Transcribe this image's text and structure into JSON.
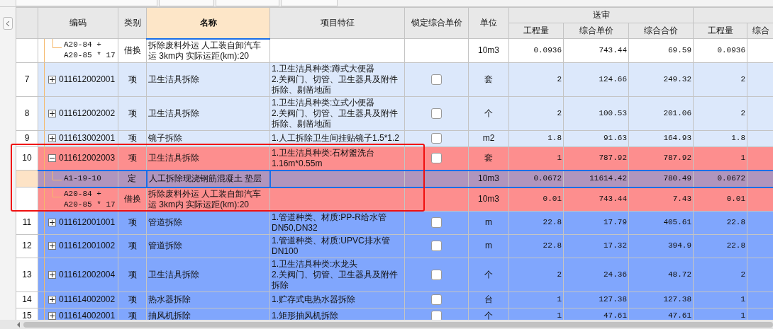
{
  "columns": [
    {
      "label": "编码",
      "selected": false
    },
    {
      "label": "类别",
      "selected": false
    },
    {
      "label": "名称",
      "selected": true
    },
    {
      "label": "项目特征",
      "selected": false
    },
    {
      "label": "锁定综合单价",
      "selected": false
    },
    {
      "label": "单位",
      "selected": false
    }
  ],
  "groups": [
    {
      "label": "送审",
      "columns": [
        "工程量",
        "综合单价",
        "综合合价"
      ]
    },
    {
      "columns": [
        "工程量",
        "综合"
      ]
    }
  ],
  "rows": [
    {
      "kind": "sub",
      "code": "A20-84 +\nA20-85 * 17",
      "type": "借换",
      "name": "拆除废料外运 人工装自卸汽车运 3km内  实际运距(km):20",
      "unit": "10m3",
      "values": [
        "0.0936",
        "743.44",
        "69.59",
        "0.0936"
      ],
      "color": "#ffffff",
      "selected": false
    },
    {
      "kind": "item",
      "number": "7",
      "expanded": false,
      "code": "011612002001",
      "type": "项",
      "name": "卫生洁具拆除",
      "features": "1.卫生洁具种类:蹲式大便器\n2.关阀门、切管、卫生器具及附件拆除、剔凿地面",
      "locked": false,
      "unit": "套",
      "values": [
        "2",
        "124.66",
        "249.32",
        "2"
      ],
      "color": "#dce8fb",
      "selected": false
    },
    {
      "kind": "item",
      "number": "8",
      "expanded": false,
      "code": "011612002002",
      "type": "项",
      "name": "卫生洁具拆除",
      "features": "1.卫生洁具种类:立式小便器\n2.关阀门、切管、卫生器具及附件拆除、剔凿地面",
      "locked": false,
      "unit": "个",
      "values": [
        "2",
        "100.53",
        "201.06",
        "2"
      ],
      "color": "#dce8fb",
      "selected": false
    },
    {
      "kind": "item",
      "number": "9",
      "expanded": false,
      "code": "011613002001",
      "type": "项",
      "name": "镜子拆除",
      "features": "1.人工拆除卫生间挂贴镜子1.5*1.2",
      "locked": false,
      "unit": "m2",
      "values": [
        "1.8",
        "91.63",
        "164.93",
        "1.8"
      ],
      "color": "#dce8fb",
      "selected": false
    },
    {
      "kind": "item",
      "number": "10",
      "expanded": true,
      "code": "011612002003",
      "type": "项",
      "name": "卫生洁具拆除",
      "features": "1.卫生洁具种类:石材盥洗台\n1.16m*0.55m",
      "locked": false,
      "unit": "套",
      "values": [
        "1",
        "787.92",
        "787.92",
        "1"
      ],
      "color": "#fd8e8e",
      "selected": false
    },
    {
      "kind": "sub",
      "code": "A1-19-10",
      "type": "定",
      "name": "人工拆除现浇钢筋混凝土 垫层",
      "unit": "10m3",
      "values": [
        "0.0672",
        "11614.42",
        "780.49",
        "0.0672"
      ],
      "color": "#b095bd",
      "selected": true
    },
    {
      "kind": "sub",
      "code": "A20-84 +\nA20-85 * 17",
      "type": "借换",
      "name": "拆除废料外运 人工装自卸汽车运 3km内  实际运距(km):20",
      "unit": "10m3",
      "values": [
        "0.01",
        "743.44",
        "7.43",
        "0.01"
      ],
      "color": "#fd8e8e",
      "selected": false
    },
    {
      "kind": "item",
      "number": "11",
      "expanded": false,
      "code": "011612001001",
      "type": "项",
      "name": "管道拆除",
      "features": "1.管道种类、材质:PP-R给水管\nDN50,DN32",
      "locked": false,
      "unit": "m",
      "values": [
        "22.8",
        "17.79",
        "405.61",
        "22.8"
      ],
      "color": "#80a6fd",
      "selected": false
    },
    {
      "kind": "item",
      "number": "12",
      "expanded": false,
      "code": "011612001002",
      "type": "项",
      "name": "管道拆除",
      "features": "1.管道种类、材质:UPVC排水管\nDN100",
      "locked": false,
      "unit": "m",
      "values": [
        "22.8",
        "17.32",
        "394.9",
        "22.8"
      ],
      "color": "#80a6fd",
      "selected": false
    },
    {
      "kind": "item",
      "number": "13",
      "expanded": false,
      "code": "011612002004",
      "type": "项",
      "name": "卫生洁具拆除",
      "features": "1.卫生洁具种类:水龙头\n2.关阀门、切管、卫生器具及附件拆除",
      "locked": false,
      "unit": "个",
      "values": [
        "2",
        "24.36",
        "48.72",
        "2"
      ],
      "color": "#80a6fd",
      "selected": false
    },
    {
      "kind": "item",
      "number": "14",
      "expanded": false,
      "code": "011614002002",
      "type": "项",
      "name": "热水器拆除",
      "features": "1.贮存式电热水器拆除",
      "locked": false,
      "unit": "台",
      "values": [
        "1",
        "127.38",
        "127.38",
        "1"
      ],
      "color": "#80a6fd",
      "selected": false
    },
    {
      "kind": "item",
      "number": "15",
      "expanded": false,
      "code": "011614002001",
      "type": "项",
      "name": "抽风机拆除",
      "features": "1.矩形抽风机拆除",
      "locked": false,
      "unit": "个",
      "values": [
        "1",
        "47.61",
        "47.61",
        "1"
      ],
      "color": "#80a6fd",
      "selected": false
    }
  ]
}
